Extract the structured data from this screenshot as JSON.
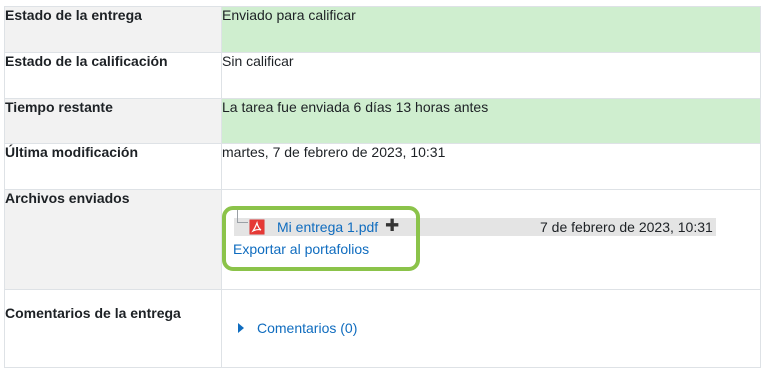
{
  "submission_status": {
    "rows": [
      {
        "label": "Estado de la entrega",
        "value": "Enviado para calificar"
      },
      {
        "label": "Estado de la calificación",
        "value": "Sin calificar"
      },
      {
        "label": "Tiempo restante",
        "value": "La tarea fue enviada 6 días 13 horas antes"
      },
      {
        "label": "Última modificación",
        "value": "martes, 7 de febrero de 2023, 10:31"
      },
      {
        "label": "Archivos enviados"
      },
      {
        "label": "Comentarios de la entrega"
      }
    ],
    "files": [
      {
        "name": "Mi entrega 1.pdf",
        "date": "7 de febrero de 2023, 10:31",
        "icon": "pdf-icon"
      }
    ],
    "export_label": "Exportar al portafolios",
    "comments_label": "Comentarios (0)"
  },
  "colors": {
    "success_bg": "#cfeecf",
    "label_bg": "#f2f2f2",
    "link": "#0f6cbf",
    "highlight": "#8bc34a"
  }
}
